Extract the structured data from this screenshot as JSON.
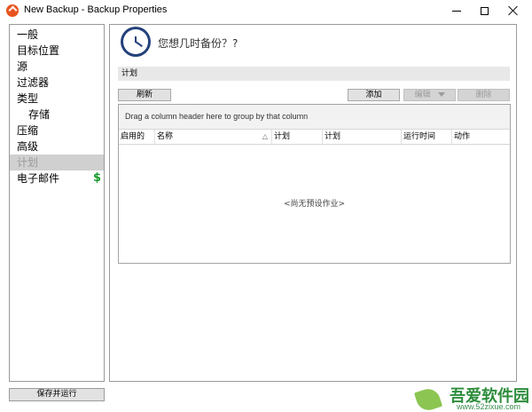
{
  "window": {
    "title": "New Backup - Backup Properties"
  },
  "sidebar": {
    "items": [
      {
        "label": "一般"
      },
      {
        "label": "目标位置"
      },
      {
        "label": "源"
      },
      {
        "label": "过滤器"
      },
      {
        "label": "类型"
      },
      {
        "label": "存储"
      },
      {
        "label": "压缩"
      },
      {
        "label": "高级"
      },
      {
        "label": "计划"
      },
      {
        "label": "电子邮件",
        "badge": "$"
      }
    ],
    "active_item": "计划"
  },
  "footer": {
    "save_run_label": "保存并运行"
  },
  "main": {
    "question": "您想几时备份？?",
    "section_title": "计划",
    "buttons": {
      "refresh": "刷新",
      "add": "添加",
      "edit": "编辑",
      "delete": "删除"
    },
    "grid": {
      "group_hint": "Drag a column header here to group by that column",
      "columns": [
        "启用的",
        "名称",
        "计划",
        "计划",
        "运行时间",
        "动作"
      ],
      "sort_column": "名称",
      "empty_message": "<尚无预设作业>"
    }
  },
  "watermark": {
    "name": "吾爱软件园",
    "url": "www.52zixue.com"
  },
  "colors": {
    "accent": "#24417a",
    "selected_row": "#d0d0d0",
    "badge": "#149a29",
    "brand_icon": "#e8541f"
  }
}
